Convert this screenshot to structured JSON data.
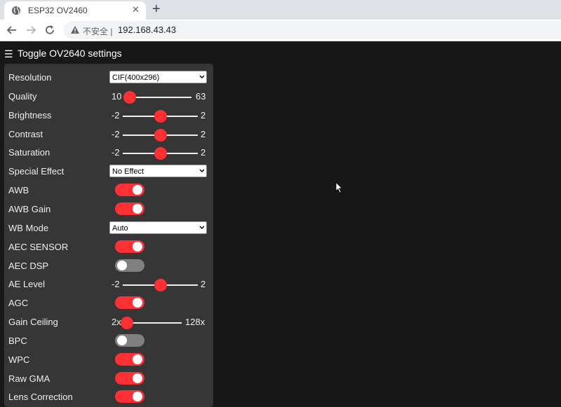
{
  "browser": {
    "tab_title": "ESP32 OV2460",
    "tab_close": "✕",
    "new_tab": "+",
    "insecure_label": "不安全 |",
    "url": "192.168.43.43"
  },
  "page": {
    "menu_glyph": "☰",
    "toggle_label": "Toggle OV2640 settings"
  },
  "controls": [
    {
      "label": "Resolution",
      "type": "select",
      "value": "CIF(400x296)"
    },
    {
      "label": "Quality",
      "type": "range",
      "min": "10",
      "max": "63",
      "value": 10
    },
    {
      "label": "Brightness",
      "type": "range",
      "min": "-2",
      "max": "2",
      "value": 0
    },
    {
      "label": "Contrast",
      "type": "range",
      "min": "-2",
      "max": "2",
      "value": 0
    },
    {
      "label": "Saturation",
      "type": "range",
      "min": "-2",
      "max": "2",
      "value": 0
    },
    {
      "label": "Special Effect",
      "type": "select",
      "value": "No Effect"
    },
    {
      "label": "AWB",
      "type": "toggle",
      "on": true
    },
    {
      "label": "AWB Gain",
      "type": "toggle",
      "on": true
    },
    {
      "label": "WB Mode",
      "type": "select",
      "value": "Auto"
    },
    {
      "label": "AEC SENSOR",
      "type": "toggle",
      "on": true
    },
    {
      "label": "AEC DSP",
      "type": "toggle",
      "on": false
    },
    {
      "label": "AE Level",
      "type": "range",
      "min": "-2",
      "max": "2",
      "value": 0
    },
    {
      "label": "AGC",
      "type": "toggle",
      "on": true
    },
    {
      "label": "Gain Ceiling",
      "type": "range",
      "min": "2x",
      "max": "128x",
      "value": 0
    },
    {
      "label": "BPC",
      "type": "toggle",
      "on": false
    },
    {
      "label": "WPC",
      "type": "toggle",
      "on": true
    },
    {
      "label": "Raw GMA",
      "type": "toggle",
      "on": true
    },
    {
      "label": "Lens Correction",
      "type": "toggle",
      "on": true
    }
  ],
  "colors": {
    "accent": "#ff3034",
    "panel": "#363636",
    "background": "#181818"
  }
}
